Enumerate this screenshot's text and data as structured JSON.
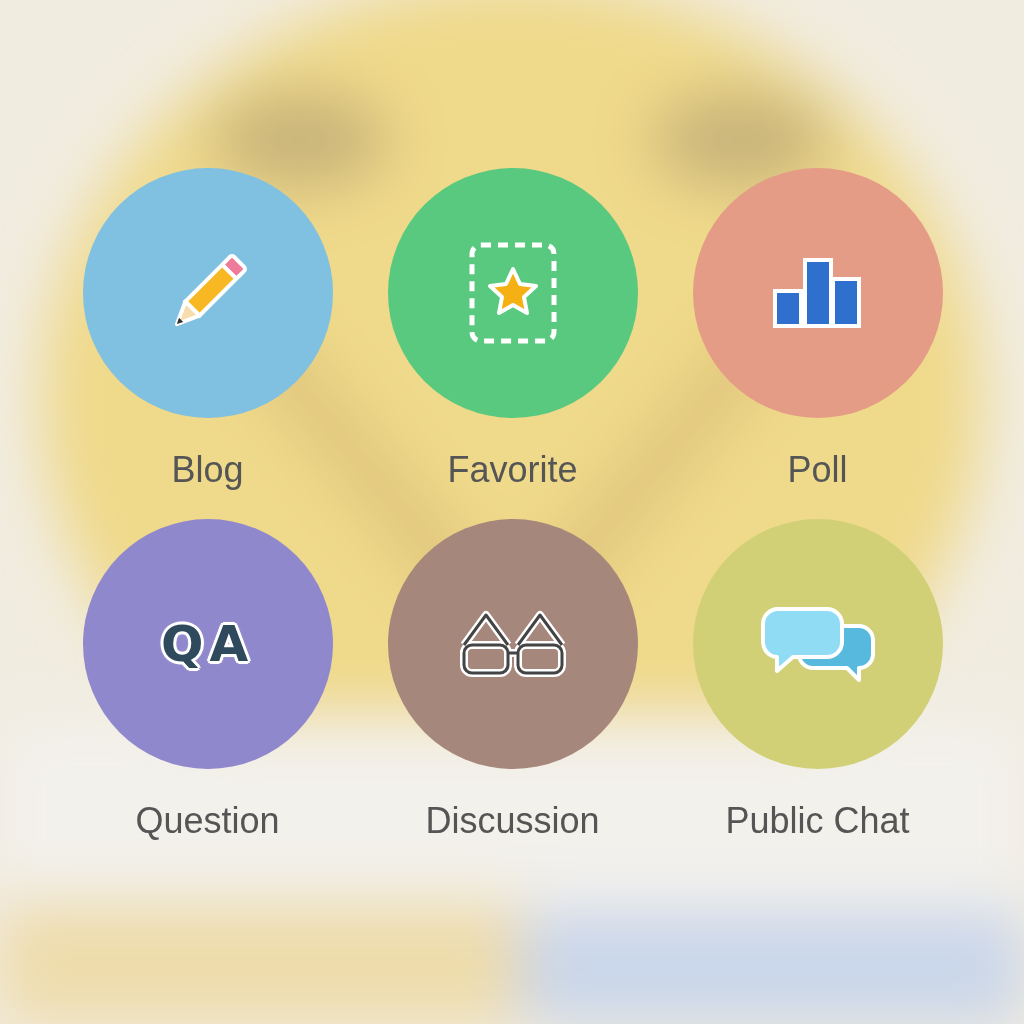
{
  "options": [
    {
      "kind": "blog",
      "label": "Blog",
      "color": "#80c0e0"
    },
    {
      "kind": "favorite",
      "label": "Favorite",
      "color": "#58c97e"
    },
    {
      "kind": "poll",
      "label": "Poll",
      "color": "#e59c86"
    },
    {
      "kind": "question",
      "label": "Question",
      "color": "#9088cc",
      "icon_text": "QA"
    },
    {
      "kind": "discussion",
      "label": "Discussion",
      "color": "#a6877b"
    },
    {
      "kind": "chat",
      "label": "Public Chat",
      "color": "#d1d077"
    }
  ]
}
